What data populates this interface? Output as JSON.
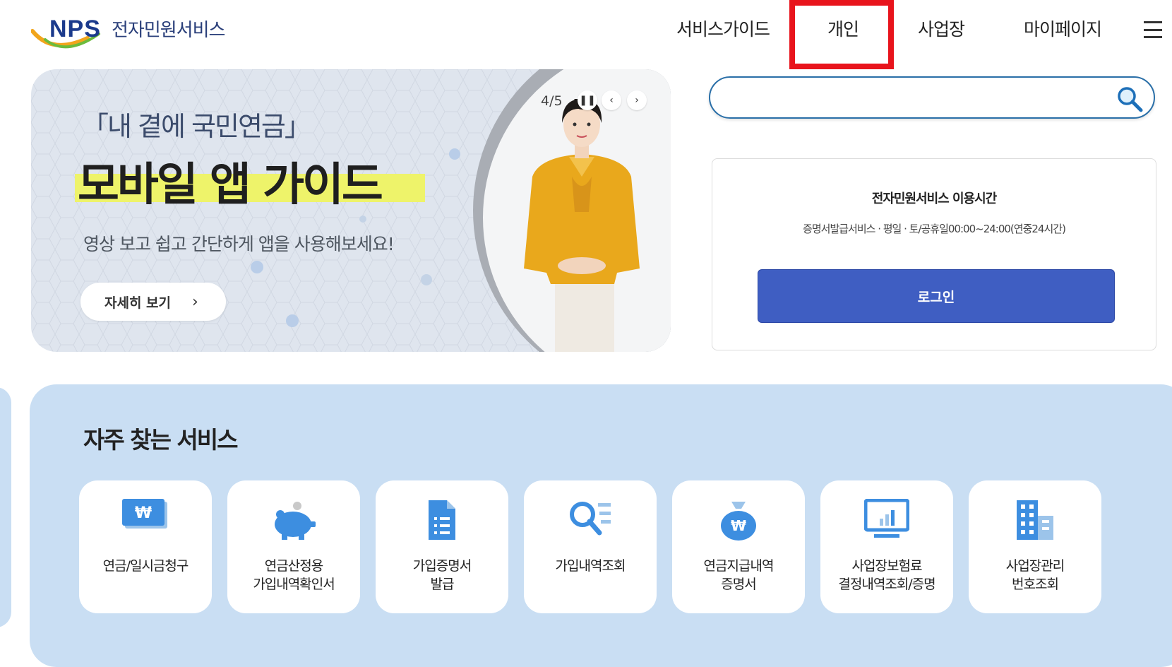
{
  "header": {
    "logo_text": "NPS",
    "service_title": "전자민원서비스",
    "nav": [
      "서비스가이드",
      "개인",
      "사업장",
      "마이페이지"
    ],
    "menu_icon": "hamburger-icon"
  },
  "banner": {
    "subtitle": "「내 곁에 국민연금」",
    "title": "모바일 앱 가이드",
    "description": "영상 보고 쉽고 간단하게 앱을 사용해보세요!",
    "button_label": "자세히 보기",
    "page_indicator": "4/5"
  },
  "search": {
    "placeholder": "",
    "icon": "search-icon"
  },
  "info": {
    "title": "전자민원서비스 이용시간",
    "detail": "증명서발급서비스 · 평일 · 토/공휴일00:00~24:00(연중24시간)",
    "login_label": "로그인"
  },
  "frequent": {
    "heading": "자주 찾는 서비스",
    "items": [
      {
        "label": "연금/일시금청구",
        "icon": "won-card-icon"
      },
      {
        "label": "연금산정용\n가입내역확인서",
        "icon": "piggy-bank-icon"
      },
      {
        "label": "가입증명서\n발급",
        "icon": "document-icon"
      },
      {
        "label": "가입내역조회",
        "icon": "magnifier-list-icon"
      },
      {
        "label": "연금지급내역\n증명서",
        "icon": "money-bag-icon"
      },
      {
        "label": "사업장보험료\n결정내역조회/증명",
        "icon": "monitor-chart-icon"
      },
      {
        "label": "사업장관리\n번호조회",
        "icon": "building-icon"
      }
    ]
  },
  "colors": {
    "brand_navy": "#1b3a8c",
    "highlight_red": "#e8141c",
    "login_blue": "#3f5ec2",
    "section_bg": "#c9def3",
    "icon_blue": "#3d8ee0"
  }
}
